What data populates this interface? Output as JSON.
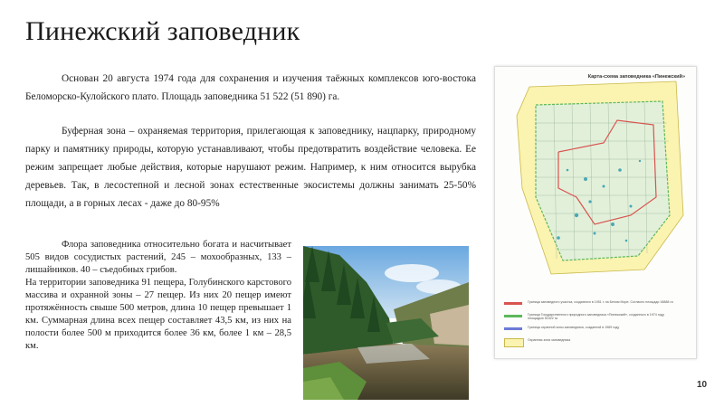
{
  "slide": {
    "title": "Пинежский заповедник",
    "paragraph_founding": "Основан 20 августа 1974 года для сохранения и изучения таёжных комплексов юго-востока Беломорско-Кулойского плато. Площадь заповедника 51 522 (51 890) га.",
    "paragraph_buffer": "Буферная зона – охраняемая территория, прилегающая к заповеднику, нацпарку, природному парку и памятнику природы, которую устанавливают, чтобы предотвратить воздействие человека. Ее режим запрещает любые действия, которые нарушают режим. Например, к ним относится вырубка деревьев. Так, в лесостепной и лесной зонах естественные экосистемы должны занимать 25-50% площади, а в горных лесах - даже до 80-95%",
    "paragraph_flora": "Флора заповедника относительно богата и насчитывает 505 видов сосудистых растений, 245 – мохообразных, 133 – лишайников. 40 – съедобных грибов.",
    "paragraph_caves": "На территории заповедника 91 пещера, Голубинского карстового массива и охранной зоны – 27 пещер. Из них 20 пещер имеют протяжённость свыше 500 метров, длина 10 пещер превышает 1 км. Суммарная длина всех пещер составляет 43,5 км, из них на полости более 500 м приходится более 36 км, более 1 км – 28,5 км.",
    "page_number": "10"
  },
  "map": {
    "title": "Карта-схема заповедника «Пинежский»",
    "legend": [
      {
        "color": "#d9534f",
        "text": "Граница заповедного участка, созданного в 1951 г. на Белом Море. Согласно площади 18888 га"
      },
      {
        "color": "#5cb85c",
        "text": "Граница Государственного природного заповедника «Пинежский», созданного в 1974 году, площадью 51522 га"
      },
      {
        "color": "#6c7bd6",
        "text": "Граница охранной зоны заповедника, созданной в 1989 году"
      },
      {
        "color": "#fbf3b0",
        "text": "Охранная зона заповедника"
      }
    ]
  }
}
